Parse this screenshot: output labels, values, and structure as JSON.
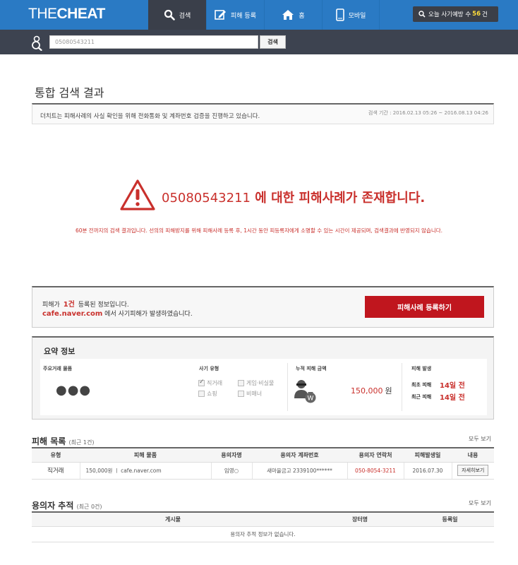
{
  "header": {
    "logo_thin": "THE",
    "logo_bold": "CHEAT",
    "nav": {
      "search": "검색",
      "report": "피해 등록",
      "home": "홈",
      "mobile": "모바일"
    },
    "fraud_count_label": "오늘 사기예방 수",
    "fraud_count_value": "56",
    "fraud_count_unit": "건"
  },
  "search": {
    "value": "05080543211",
    "button": "검색"
  },
  "page_title": "통합 검색 결과",
  "info": {
    "text": "더치트는 피해사례의 사실 확인을 위해 전화통화 및 계좌번호 검증을 진행하고 있습니다.",
    "period": "검색 기간 : 2016.02.13 05:26 ~ 2016.08.13 04:26"
  },
  "warning": {
    "number": "05080543211",
    "message": " 에 대한 피해사례가 존재합니다.",
    "note": "60분 전까지의 검색 결과입니다. 선의의 피해방지를 위해 피해사례 등록 후, 1시간 동안 피등록자에게 소명할 수 있는 시간이 제공되며, 검색결과에 반영되지 않습니다."
  },
  "registration": {
    "prefix": "피해가",
    "count": "1건",
    "suffix": "등록된 정보입니다.",
    "site": "cafe.naver.com",
    "site_suffix": " 에서 사기피해가 발생하였습니다.",
    "button": "피해사례 등록하기"
  },
  "summary": {
    "title": "요약 정보",
    "items_label": "주요거래 물품",
    "items_value": "●●●",
    "type_label": "사기 유형",
    "types": [
      {
        "label": "직거래",
        "checked": true
      },
      {
        "label": "게임·비실물",
        "checked": false
      },
      {
        "label": "쇼핑",
        "checked": false
      },
      {
        "label": "비매너",
        "checked": false
      }
    ],
    "amount_label": "누적 피해 금액",
    "amount_value": "150,000",
    "amount_unit": "원",
    "damage_label": "피해 발생",
    "first_label": "최초 피해",
    "first_value": "14일 전",
    "recent_label": "최근 피해",
    "recent_value": "14일 전"
  },
  "damage_list": {
    "title": "피해 목록",
    "sub": "(최근 1건)",
    "see_all": "모두 보기",
    "headers": [
      "유형",
      "피해 물품",
      "용의자명",
      "용의자 계좌번호",
      "용의자 연락처",
      "피해발생일",
      "내용"
    ],
    "rows": [
      {
        "type": "직거래",
        "item": "150,000원 ㅣ cafe.naver.com",
        "name": "임영○",
        "account": "새마을금고 2339100******",
        "phone": "050-8054-3211",
        "date": "2016.07.30",
        "detail": "자세히보기"
      }
    ]
  },
  "tracking": {
    "title": "용의자 추적",
    "sub": "(최근 0건)",
    "see_all": "모두 보기",
    "headers": [
      "게시물",
      "장터명",
      "등록일"
    ],
    "empty": "용의자 추적 정보가 없습니다."
  },
  "colors": {
    "brand_blue": "#2a7ac4",
    "accent_red": "#c0161e",
    "dark_bar": "#3d4350"
  }
}
